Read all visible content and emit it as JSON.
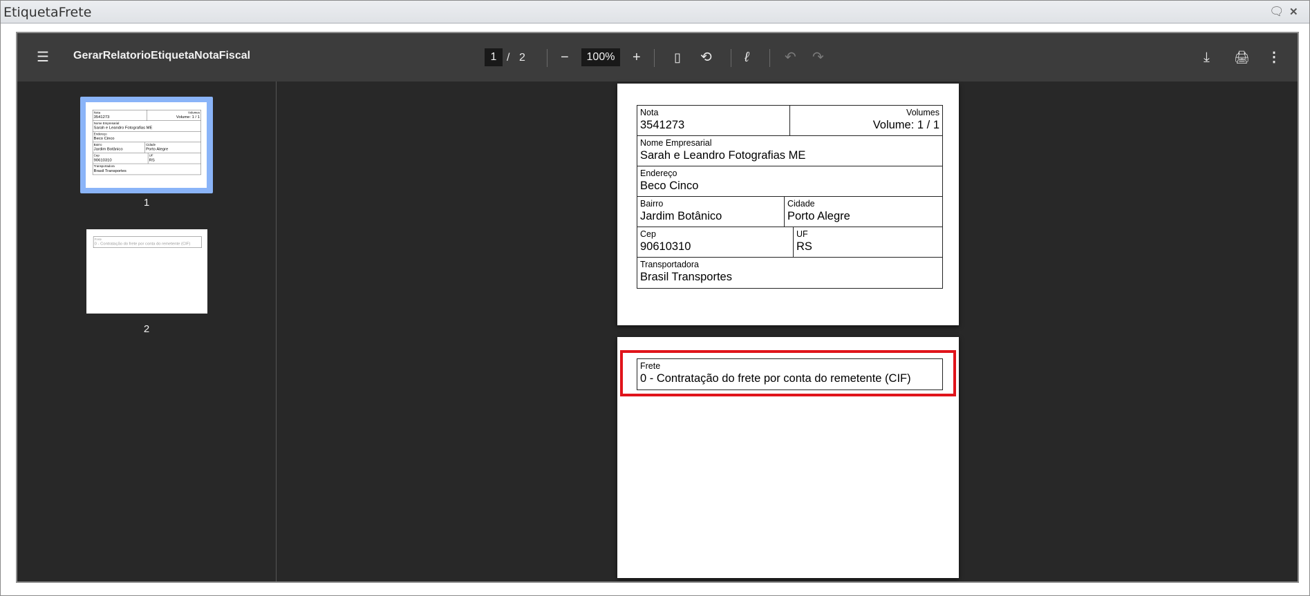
{
  "window": {
    "title": "EtiquetaFrete"
  },
  "toolbar": {
    "document_title": "GerarRelatorioEtiquetaNotaFiscal",
    "current_page": "1",
    "page_separator": "/",
    "total_pages": "2",
    "zoom": "100%"
  },
  "thumbnails": [
    {
      "label": "1",
      "selected": true
    },
    {
      "label": "2",
      "selected": false
    }
  ],
  "page1": {
    "nota_label": "Nota",
    "nota": "3541273",
    "volumes_label": "Volumes",
    "volumes": "Volume: 1 / 1",
    "nome_label": "Nome Empresarial",
    "nome": "Sarah e Leandro Fotografias ME",
    "endereco_label": "Endereço",
    "endereco": "Beco Cinco",
    "bairro_label": "Bairro",
    "bairro": "Jardim Botânico",
    "cidade_label": "Cidade",
    "cidade": "Porto Alegre",
    "cep_label": "Cep",
    "cep": "90610310",
    "uf_label": "UF",
    "uf": "RS",
    "transportadora_label": "Transportadora",
    "transportadora": "Brasil Transportes"
  },
  "page2": {
    "frete_label": "Frete",
    "frete": "0 - Contratação do frete por conta do remetente (CIF)"
  },
  "colors": {
    "highlight": "#e0141b",
    "thumb_selected": "#8ab4f8"
  }
}
